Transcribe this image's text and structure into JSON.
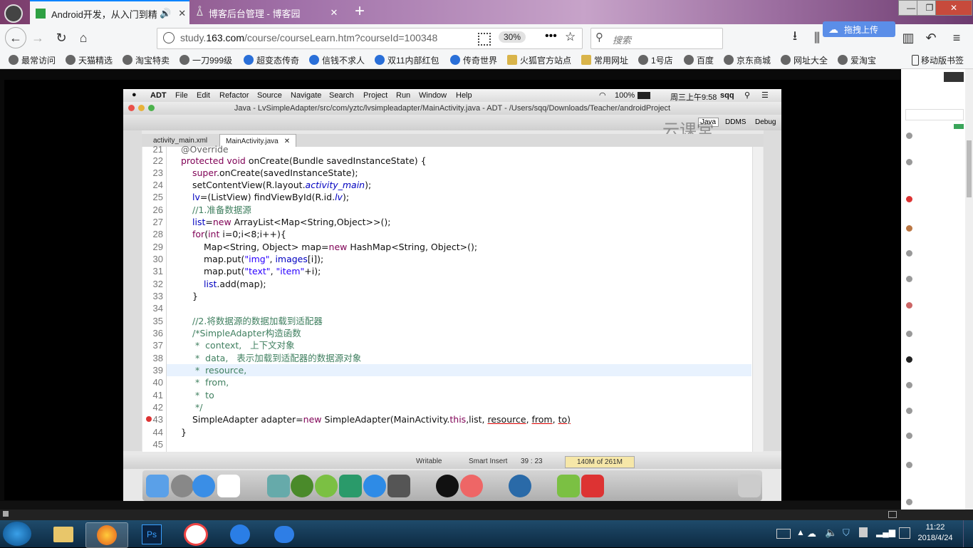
{
  "browser": {
    "tabs": [
      {
        "title": "Android开发，从入门到精",
        "active": true
      },
      {
        "title": "博客后台管理 - 博客园",
        "active": false
      }
    ],
    "new_tab": "+",
    "window_controls": {
      "minimize": "—",
      "restore": "❐",
      "close": "✕"
    },
    "url": {
      "prefix": "study.",
      "domain": "163.com",
      "rest": "/course/courseLearn.htm?courseId=100348",
      "zoom": "30%"
    },
    "search_placeholder": "搜索",
    "upload_button": "拖拽上传",
    "bookmarks": [
      "最常访问",
      "天猫精选",
      "淘宝特卖",
      "一刀999级",
      "超变态传奇",
      "信钱不求人",
      "双11内部红包",
      "传奇世界",
      "火狐官方站点",
      "常用网址",
      "1号店",
      "百度",
      "京东商城",
      "网址大全",
      "爱淘宝"
    ],
    "mobile_bookmarks": "移动版书签"
  },
  "mac": {
    "menu": [
      "ADT",
      "File",
      "Edit",
      "Refactor",
      "Source",
      "Navigate",
      "Search",
      "Project",
      "Run",
      "Window",
      "Help"
    ],
    "menu_right": {
      "battery": "100%",
      "time": "周三上午9:58",
      "user": "sqq"
    },
    "window_title": "Java - LvSimpleAdapter/src/com/yztc/lvsimpleadapter/MainActivity.java - ADT - /Users/sqq/Downloads/Teacher/androidProject",
    "perspectives": [
      "Java",
      "DDMS",
      "Debug"
    ],
    "watermark": "云课堂",
    "editor_tabs": [
      "activity_main.xml",
      "MainActivity.java"
    ],
    "status": {
      "writable": "Writable",
      "insert": "Smart Insert",
      "position": "39 : 23",
      "memory": "140M of 261M"
    }
  },
  "code": {
    "line_numbers": [
      "21",
      "22",
      "23",
      "24",
      "25",
      "26",
      "27",
      "28",
      "29",
      "30",
      "31",
      "32",
      "33",
      "34",
      "35",
      "36",
      "37",
      "38",
      "39",
      "40",
      "41",
      "42",
      "43",
      "44",
      "45"
    ],
    "l21": "@Override",
    "l22a": "protected void ",
    "l22b": "onCreate(Bundle savedInstanceState) {",
    "l23a": "super",
    "l23b": ".onCreate(savedInstanceState);",
    "l24a": "setContentView(R.layout.",
    "l24b": "activity_main",
    "l24c": ");",
    "l25a": "lv",
    "l25b": "=(ListView) findViewById(R.id.",
    "l25c": "lv",
    "l25d": ");",
    "l26": "//1.准备数据源",
    "l27a": "list",
    "l27b": "=",
    "l27c": "new",
    "l27d": " ArrayList<Map<String,Object>>();",
    "l28a": "for",
    "l28b": "(",
    "l28c": "int",
    "l28d": " i=0;i<8;i++){",
    "l29a": "Map<String, Object> map=",
    "l29b": "new",
    "l29c": " HashMap<String, Object>();",
    "l30a": "map.put(",
    "l30b": "\"img\"",
    "l30c": ", ",
    "l30d": "images",
    "l30e": "[i]);",
    "l31a": "map.put(",
    "l31b": "\"text\"",
    "l31c": ", ",
    "l31d": "\"item\"",
    "l31e": "+i);",
    "l32a": "list",
    "l32b": ".add(map);",
    "l33": "}",
    "l35": "//2.将数据源的数据加载到适配器",
    "l36": "/*SimpleAdapter构造函数",
    "l37": " *  context,   上下文对象",
    "l38": " *  data,   表示加载到适配器的数据源对象",
    "l39": " *  resource,",
    "l40": " *  from,",
    "l41": " *  to",
    "l42": " */",
    "l43a": "SimpleAdapter adapter=",
    "l43b": "new",
    "l43c": " SimpleAdapter(MainActivity.",
    "l43d": "this",
    "l43e": ",list, ",
    "l43f": "resource",
    "l43g": ", ",
    "l43h": "from",
    "l43i": ", ",
    "l43j": "to",
    "l43k": ")",
    "l44": "}"
  },
  "taskbar": {
    "time": "11:22",
    "date": "2018/4/24"
  }
}
